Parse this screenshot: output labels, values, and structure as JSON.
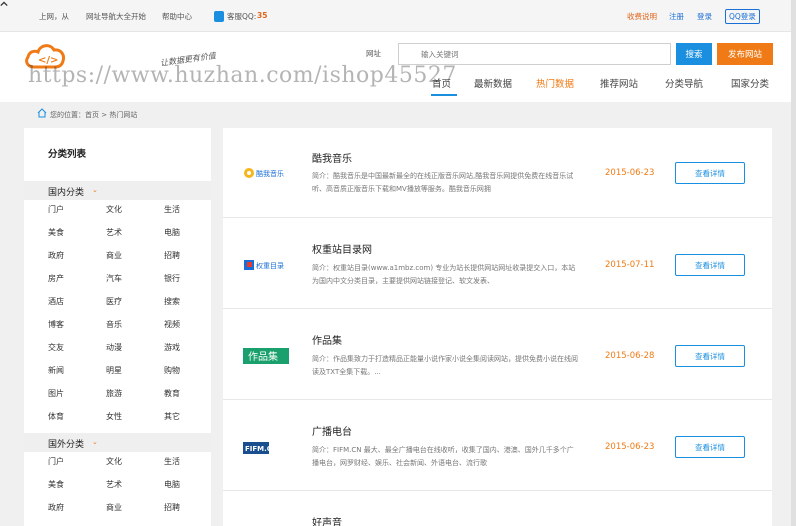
{
  "topbar": {
    "welcome": "上网，从",
    "site_nav": "网址导航大全开始",
    "help": "帮助中心",
    "customer_qq_label": "客服QQ:",
    "customer_qq_num": "35",
    "transaction": "收费说明",
    "register": "注册",
    "login": "登录",
    "qq_login": "QQ登录"
  },
  "search": {
    "label": "网址",
    "placeholder": "输入关键词",
    "button": "搜索",
    "publish": "发布网站"
  },
  "slogan": "让数据更有价值",
  "watermark": "https://www.huzhan.com/ishop45527",
  "nav": [
    "首页",
    "最新数据",
    "热门数据",
    "推荐网站",
    "分类导航",
    "国家分类"
  ],
  "breadcrumb": "您的位置：首页 > 热门网站",
  "sidebar": {
    "title": "分类列表",
    "domestic": {
      "label": "国内分类",
      "items": [
        "门户",
        "文化",
        "生活",
        "美食",
        "艺术",
        "电脑",
        "政府",
        "商业",
        "招聘",
        "房产",
        "汽车",
        "银行",
        "酒店",
        "医疗",
        "搜索",
        "博客",
        "音乐",
        "视频",
        "交友",
        "动漫",
        "游戏",
        "新闻",
        "明星",
        "购物",
        "图片",
        "旅游",
        "教育",
        "体育",
        "女性",
        "其它"
      ]
    },
    "foreign": {
      "label": "国外分类",
      "items": [
        "门户",
        "文化",
        "生活",
        "美食",
        "艺术",
        "电脑",
        "政府",
        "商业",
        "招聘"
      ]
    }
  },
  "cards": [
    {
      "logo": "酷我音乐",
      "title": "酷我音乐",
      "desc": "简介：酷我音乐是中国最新最全的在线正版音乐网站,酷我音乐网提供免费在线音乐试听、高音质正版音乐下载和MV播放等服务。酷我音乐网拥",
      "date": "2015-06-23",
      "button": "查看详情"
    },
    {
      "logo": "权重目录",
      "title": "权重站目录网",
      "desc": "简介：权重站目录(www.a1mbz.com) 专业为站长提供网站网址收录提交入口，本站为国内中文分类目录，主要提供网站链接登记、软文发表、",
      "date": "2015-07-11",
      "button": "查看详情"
    },
    {
      "logo": "作品集",
      "title": "作品集",
      "desc": "简介：作品集致力于打造精品正能量小说作家小说全集阅读网站，提供免费小说在线阅读及TXT全集下载。...",
      "date": "2015-06-28",
      "button": "查看详情"
    },
    {
      "logo": "FIFM.CN",
      "title": "广播电台",
      "desc": "简介：FIFM.CN 最大、最全广播电台在线收听，收集了国内、港澳、国外几千多个广播电台，网罗财经、娱乐、社会新闻、外语电台、流行歌",
      "date": "2015-06-23",
      "button": "查看详情"
    },
    {
      "title": "好声音"
    }
  ],
  "colors": {
    "accent_blue": "#1a8fe0",
    "accent_orange": "#f07b16"
  }
}
